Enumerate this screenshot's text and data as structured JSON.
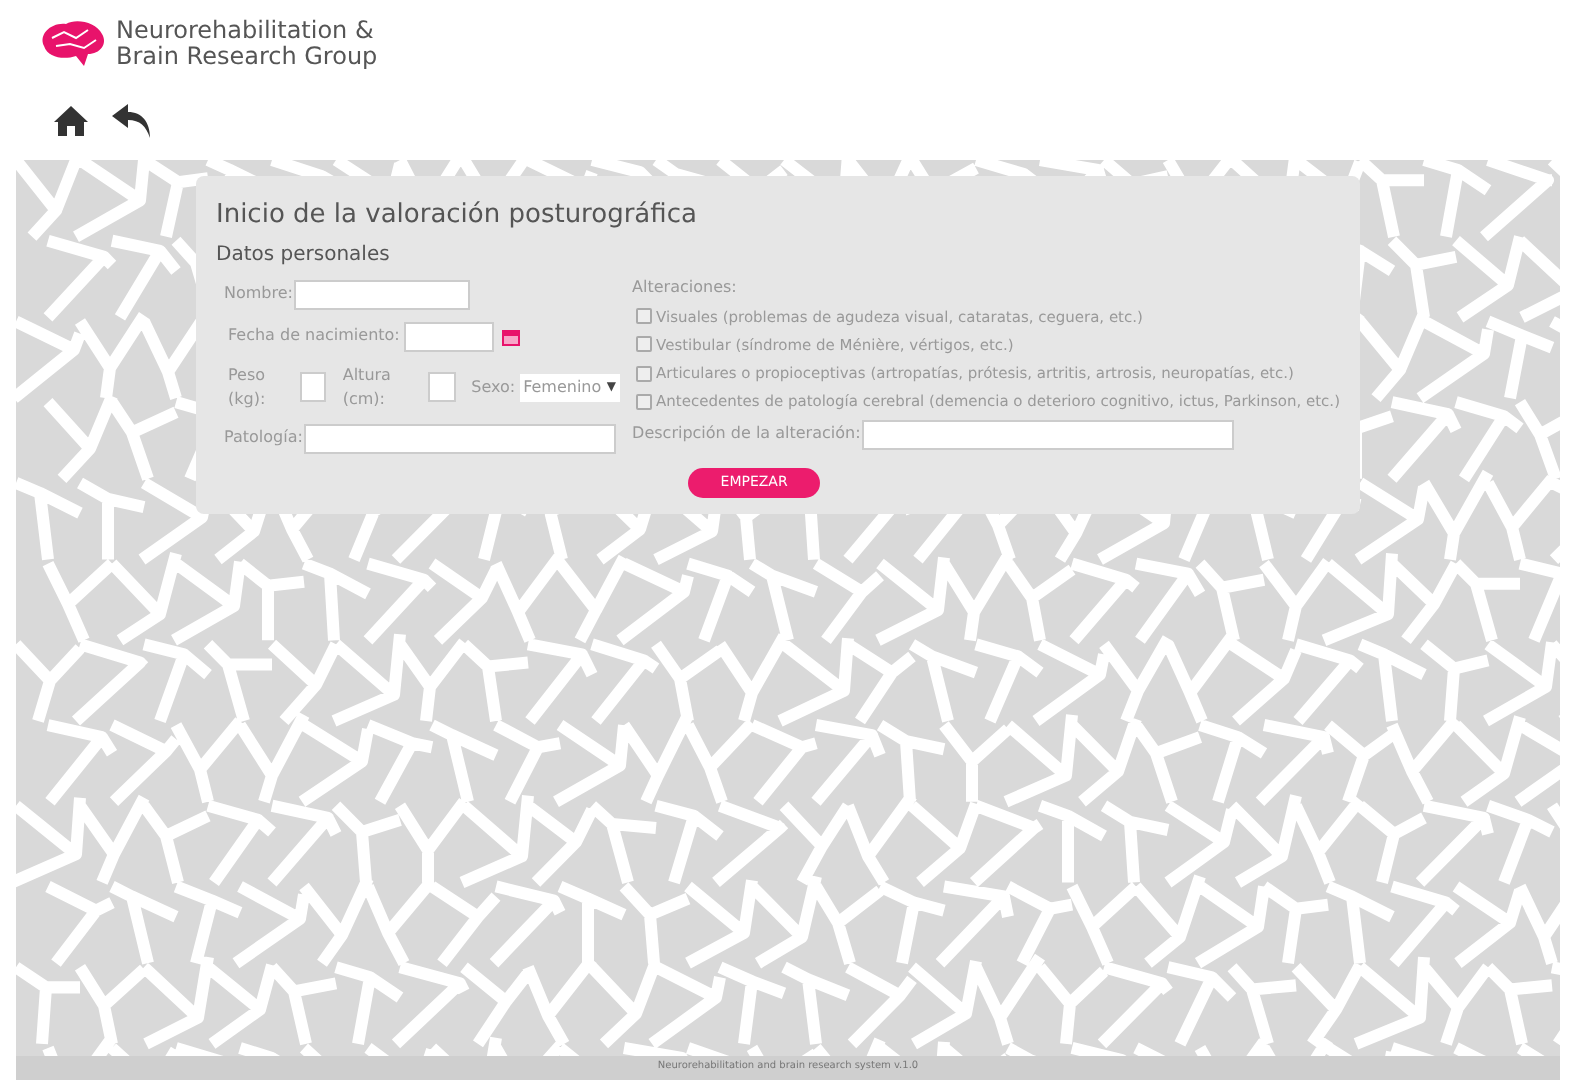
{
  "logo": {
    "line1": "Neurorehabilitation &",
    "line2": "Brain Research Group"
  },
  "form": {
    "title": "Inicio de la valoración posturográfica",
    "section": "Datos personales",
    "nombre_label": "Nombre:",
    "fecha_label": "Fecha de nacimiento:",
    "peso_label": "Peso (kg):",
    "altura_label": "Altura (cm):",
    "sexo_label": "Sexo:",
    "sexo_value": "Femenino",
    "sexo_caret": "▼",
    "patologia_label": "Patología:",
    "alteraciones_label": "Alteraciones:",
    "alteraciones": [
      {
        "label": "Visuales (problemas de agudeza visual, cataratas, ceguera, etc.)",
        "checked": false
      },
      {
        "label": "Vestibular (síndrome de Ménière, vértigos, etc.)",
        "checked": false
      },
      {
        "label": "Articulares o propioceptivas (artropatías, prótesis, artritis, artrosis, neuropatías, etc.)",
        "checked": false
      },
      {
        "label": "Antecedentes de patología cerebral (demencia o deterioro cognitivo, ictus, Parkinson, etc.)",
        "checked": false
      }
    ],
    "descripcion_label": "Descripción de la alteración:",
    "button": "EMPEZAR"
  },
  "footer": "Neurorehabilitation and brain research system v.1.0"
}
